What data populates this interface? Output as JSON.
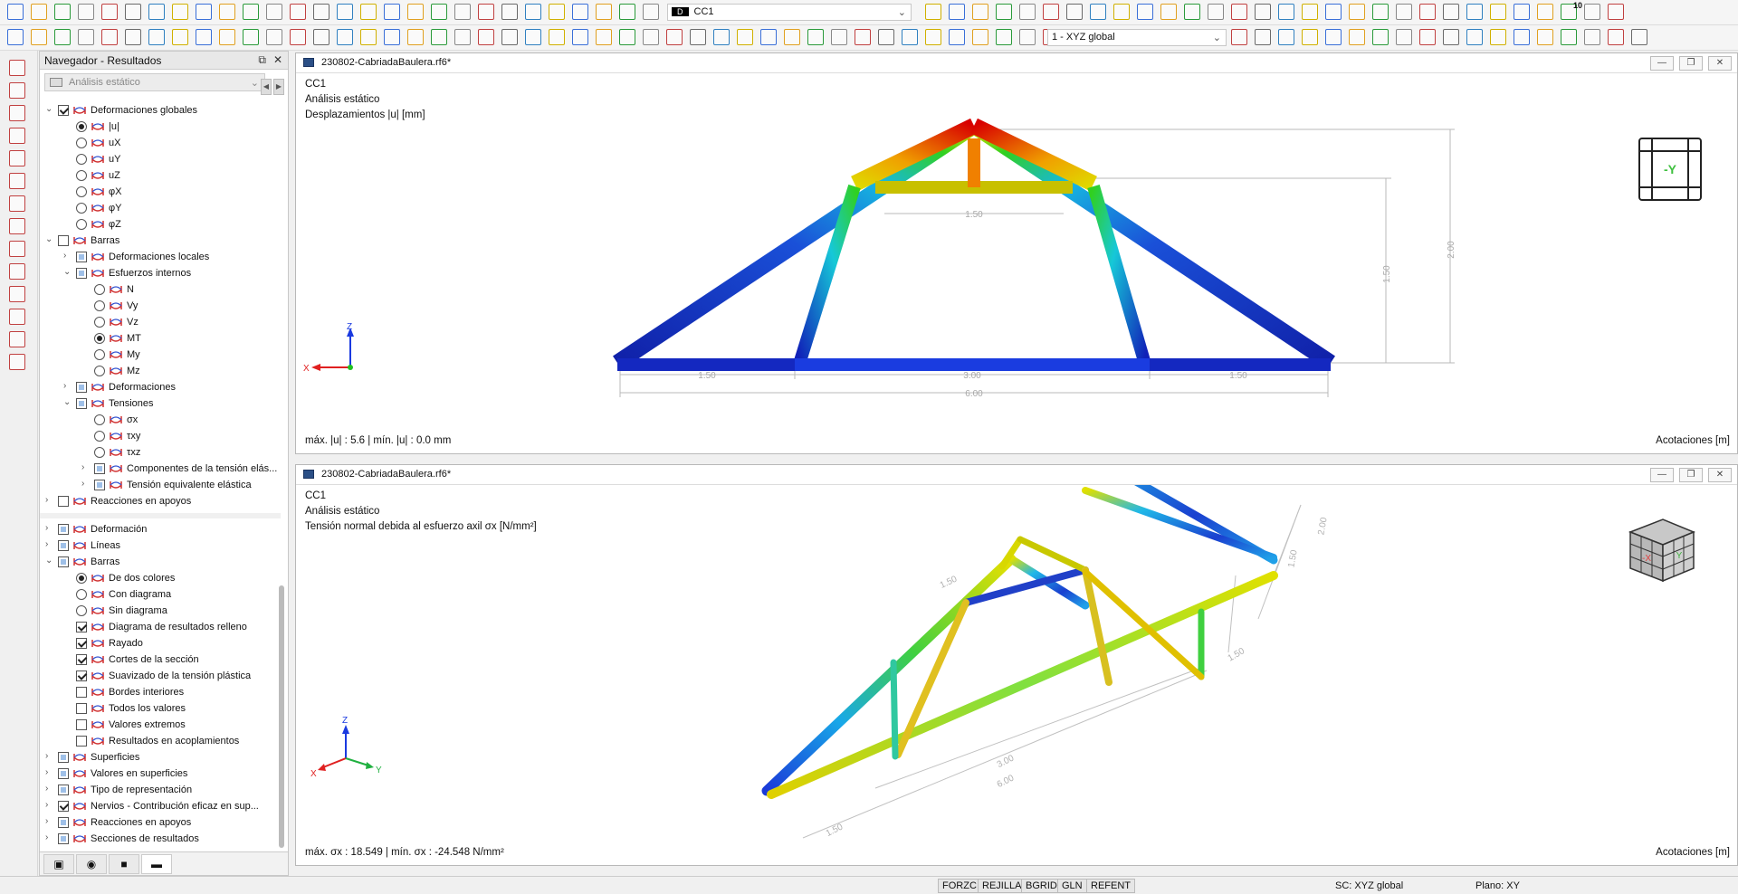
{
  "toolbar": {
    "load_case_tag": "D",
    "load_case": "CC1",
    "coord_system": "1 - XYZ global",
    "num_badge": "10"
  },
  "navigator": {
    "title": "Navegador - Resultados",
    "analysis": "Análisis estático",
    "tree_top": [
      {
        "depth": 0,
        "exp": "v",
        "ctl": "check-on",
        "label": "Deformaciones globales"
      },
      {
        "depth": 1,
        "exp": "",
        "ctl": "radio-on",
        "label": "|u|"
      },
      {
        "depth": 1,
        "exp": "",
        "ctl": "radio",
        "label": "uX"
      },
      {
        "depth": 1,
        "exp": "",
        "ctl": "radio",
        "label": "uY"
      },
      {
        "depth": 1,
        "exp": "",
        "ctl": "radio",
        "label": "uZ"
      },
      {
        "depth": 1,
        "exp": "",
        "ctl": "radio",
        "label": "φX"
      },
      {
        "depth": 1,
        "exp": "",
        "ctl": "radio",
        "label": "φY"
      },
      {
        "depth": 1,
        "exp": "",
        "ctl": "radio",
        "label": "φZ"
      },
      {
        "depth": 0,
        "exp": "v",
        "ctl": "check",
        "label": "Barras"
      },
      {
        "depth": 1,
        "exp": ">",
        "ctl": "check-part",
        "label": "Deformaciones locales"
      },
      {
        "depth": 1,
        "exp": "v",
        "ctl": "check-part",
        "label": "Esfuerzos internos"
      },
      {
        "depth": 2,
        "exp": "",
        "ctl": "radio",
        "label": "N"
      },
      {
        "depth": 2,
        "exp": "",
        "ctl": "radio",
        "label": "Vy"
      },
      {
        "depth": 2,
        "exp": "",
        "ctl": "radio",
        "label": "Vz"
      },
      {
        "depth": 2,
        "exp": "",
        "ctl": "radio-on",
        "label": "MT"
      },
      {
        "depth": 2,
        "exp": "",
        "ctl": "radio",
        "label": "My"
      },
      {
        "depth": 2,
        "exp": "",
        "ctl": "radio",
        "label": "Mz"
      },
      {
        "depth": 1,
        "exp": ">",
        "ctl": "check-part",
        "label": "Deformaciones"
      },
      {
        "depth": 1,
        "exp": "v",
        "ctl": "check-part",
        "label": "Tensiones"
      },
      {
        "depth": 2,
        "exp": "",
        "ctl": "radio",
        "label": "σx"
      },
      {
        "depth": 2,
        "exp": "",
        "ctl": "radio",
        "label": "τxy"
      },
      {
        "depth": 2,
        "exp": "",
        "ctl": "radio",
        "label": "τxz"
      },
      {
        "depth": 2,
        "exp": ">",
        "ctl": "check-part",
        "label": "Componentes de la tensión elás..."
      },
      {
        "depth": 2,
        "exp": ">",
        "ctl": "check-part",
        "label": "Tensión equivalente elástica"
      },
      {
        "depth": 0,
        "exp": ">",
        "ctl": "check",
        "label": "Reacciones en apoyos"
      }
    ],
    "tree_bottom": [
      {
        "depth": 0,
        "exp": ">",
        "ctl": "check-part",
        "label": "Deformación"
      },
      {
        "depth": 0,
        "exp": ">",
        "ctl": "check-part",
        "label": "Líneas"
      },
      {
        "depth": 0,
        "exp": "v",
        "ctl": "check-part",
        "label": "Barras"
      },
      {
        "depth": 1,
        "exp": "",
        "ctl": "radio-on",
        "label": "De dos colores"
      },
      {
        "depth": 1,
        "exp": "",
        "ctl": "radio",
        "label": "Con diagrama"
      },
      {
        "depth": 1,
        "exp": "",
        "ctl": "radio",
        "label": "Sin diagrama"
      },
      {
        "depth": 1,
        "exp": "",
        "ctl": "check-on",
        "label": "Diagrama de resultados relleno"
      },
      {
        "depth": 1,
        "exp": "",
        "ctl": "check-on",
        "label": "Rayado"
      },
      {
        "depth": 1,
        "exp": "",
        "ctl": "check-on",
        "label": "Cortes de la sección"
      },
      {
        "depth": 1,
        "exp": "",
        "ctl": "check-on",
        "label": "Suavizado de la tensión plástica"
      },
      {
        "depth": 1,
        "exp": "",
        "ctl": "check",
        "label": "Bordes interiores"
      },
      {
        "depth": 1,
        "exp": "",
        "ctl": "check",
        "label": "Todos los valores"
      },
      {
        "depth": 1,
        "exp": "",
        "ctl": "check",
        "label": "Valores extremos"
      },
      {
        "depth": 1,
        "exp": "",
        "ctl": "check",
        "label": "Resultados en acoplamientos"
      },
      {
        "depth": 0,
        "exp": ">",
        "ctl": "check-part",
        "label": "Superficies"
      },
      {
        "depth": 0,
        "exp": ">",
        "ctl": "check-part",
        "label": "Valores en superficies"
      },
      {
        "depth": 0,
        "exp": ">",
        "ctl": "check-part",
        "label": "Tipo de representación"
      },
      {
        "depth": 0,
        "exp": ">",
        "ctl": "check-on",
        "label": "Nervios - Contribución eficaz en sup..."
      },
      {
        "depth": 0,
        "exp": ">",
        "ctl": "check-part",
        "label": "Reacciones en apoyos"
      },
      {
        "depth": 0,
        "exp": ">",
        "ctl": "check-part",
        "label": "Secciones de resultados"
      }
    ]
  },
  "window1": {
    "title": "230802-CabriadaBaulera.rf6*",
    "load_case": "CC1",
    "analysis": "Análisis estático",
    "result": "Desplazamientos |u| [mm]",
    "footer": "máx. |u| : 5.6 | mín. |u| : 0.0 mm",
    "footer_right": "Acotaciones [m]",
    "view_label": "-Y",
    "dims": {
      "top": "1.50",
      "left": "1.50",
      "mid": "3.00",
      "right": "1.50",
      "total": "6.00",
      "h1": "1.50",
      "h2": "2.00"
    },
    "axis_z": "Z",
    "axis_x": "X"
  },
  "window2": {
    "title": "230802-CabriadaBaulera.rf6*",
    "load_case": "CC1",
    "analysis": "Análisis estático",
    "result": "Tensión normal debida al esfuerzo axil σx [N/mm²]",
    "footer": "máx. σx : 18.549 | mín. σx : -24.548 N/mm²",
    "footer_right": "Acotaciones [m]",
    "dims": {
      "top": "1.50",
      "d1": "1.50",
      "d2": "3.00",
      "d3": "6.00",
      "d4": "1.50",
      "h1": "1.50",
      "h2": "2.00"
    },
    "axis_z": "Z",
    "axis_x": "X",
    "axis_y": "Y",
    "cube_x": "-X",
    "cube_y": "Y"
  },
  "status": {
    "buttons": [
      "FORZC",
      "REJILLA",
      "BGRID",
      "GLN",
      "REFENT"
    ],
    "sc": "SC: XYZ global",
    "plane": "Plano: XY"
  }
}
